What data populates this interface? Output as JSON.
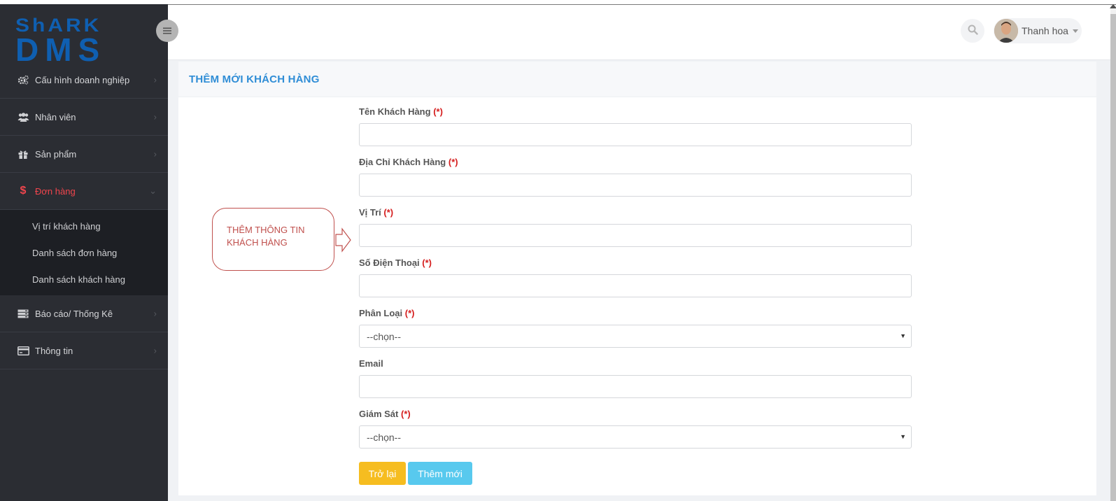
{
  "sidebar": {
    "logo": {
      "line1": "ShARK",
      "line2": "DMS"
    },
    "items": [
      {
        "label": "Cấu hình doanh nghiệp",
        "icon": "gears-icon"
      },
      {
        "label": "Nhân viên",
        "icon": "users-icon"
      },
      {
        "label": "Sản phẩm",
        "icon": "gift-icon"
      },
      {
        "label": "Đơn hàng",
        "icon": "dollar-icon",
        "active": true,
        "children": [
          {
            "label": "Vị trí khách hàng"
          },
          {
            "label": "Danh sách đơn hàng"
          },
          {
            "label": "Danh sách khách hàng"
          }
        ]
      },
      {
        "label": "Báo cáo/ Thống Kê",
        "icon": "server-icon"
      },
      {
        "label": "Thông tin",
        "icon": "credit-card-icon"
      }
    ]
  },
  "header": {
    "user_name": "Thanh hoa"
  },
  "panel": {
    "title": "THÊM MỚI KHÁCH HÀNG"
  },
  "form": {
    "required_mark": "(*)",
    "customer_name_label": "Tên Khách Hàng",
    "address_label": "Địa Chỉ Khách Hàng",
    "location_label": "Vị Trí",
    "phone_label": "Số Điện Thoại",
    "category_label": "Phân Loại",
    "category_value": "--chọn--",
    "email_label": "Email",
    "supervisor_label": "Giám Sát",
    "supervisor_value": "--chọn--",
    "back_button": "Trở lại",
    "add_button": "Thêm mới"
  },
  "annotation": {
    "line1": "THÊM THÔNG TIN",
    "line2": "KHÁCH HÀNG"
  },
  "colors": {
    "sidebar_bg": "#2b2d33",
    "active_menu": "#f1454d",
    "title_blue": "#2f8dd6",
    "required_red": "#d51d1d",
    "back_btn": "#f6bd20",
    "add_btn": "#58c9ee",
    "callout": "#c0504d"
  }
}
